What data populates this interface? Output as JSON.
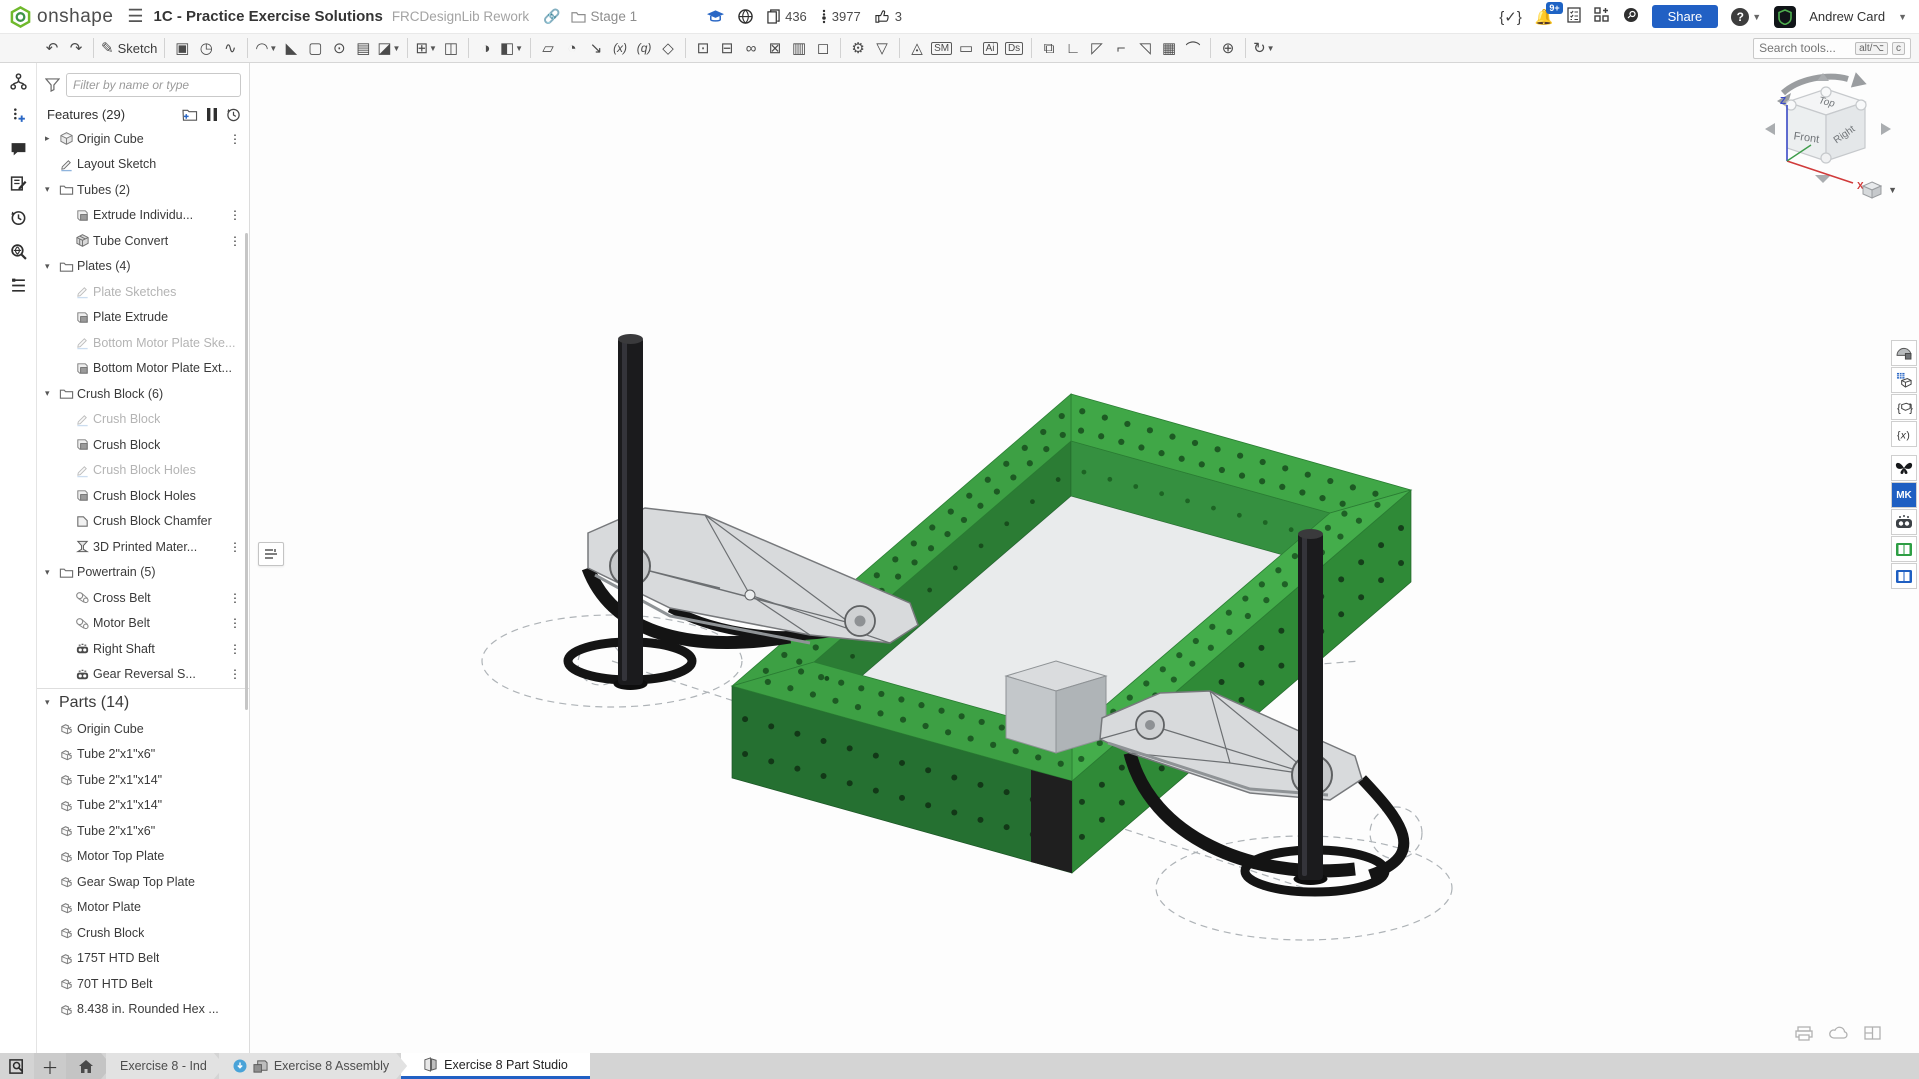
{
  "app": {
    "brand": "onshape",
    "title": "1C - Practice Exercise Solutions",
    "subtitle": "FRCDesignLib Rework",
    "workspace": "Stage 1",
    "stats": {
      "copies": "436",
      "views": "3977",
      "likes": "3"
    },
    "notification_badge": "9+",
    "share_label": "Share",
    "user_name": "Andrew Card",
    "accent_color": "#2160c4",
    "logo_green": "#6fb92c"
  },
  "left_rail": {
    "icons": [
      "versions",
      "follow",
      "comments",
      "release-notes",
      "history",
      "search",
      "feature-list"
    ]
  },
  "toolbar": {
    "sketch_label": "Sketch",
    "search_placeholder": "Search tools...",
    "shortcut_keys": [
      "alt/⌥",
      "c"
    ],
    "icons": [
      {
        "name": "undo-icon",
        "glyph": "↶"
      },
      {
        "name": "redo-icon",
        "glyph": "↷"
      },
      {
        "sep": true
      },
      {
        "name": "sketch-icon",
        "glyph": "✎",
        "label": "Sketch"
      },
      {
        "sep": true
      },
      {
        "name": "extrude-icon",
        "glyph": "▣"
      },
      {
        "name": "revolve-icon",
        "glyph": "◷"
      },
      {
        "name": "sweep-icon",
        "glyph": "∿"
      },
      {
        "sep": true
      },
      {
        "name": "fillet-icon",
        "glyph": "◠",
        "caret": true
      },
      {
        "name": "chamfer-icon",
        "glyph": "◣"
      },
      {
        "name": "shell-icon",
        "glyph": "▢"
      },
      {
        "name": "hole-icon",
        "glyph": "⊙"
      },
      {
        "name": "thread-icon",
        "glyph": "▤"
      },
      {
        "name": "draft-icon",
        "glyph": "◪",
        "caret": true
      },
      {
        "sep": true
      },
      {
        "name": "pattern-icon",
        "glyph": "⊞",
        "caret": true
      },
      {
        "name": "mirror-icon",
        "glyph": "◫"
      },
      {
        "sep": true
      },
      {
        "name": "boolean-icon",
        "glyph": "◑"
      },
      {
        "name": "split-icon",
        "glyph": "◧",
        "caret": true
      },
      {
        "sep": true
      },
      {
        "name": "plane-icon",
        "glyph": "▱"
      },
      {
        "name": "helix-icon",
        "glyph": "◔"
      },
      {
        "name": "import-icon",
        "glyph": "↘"
      },
      {
        "name": "variable-icon",
        "glyph": "(x)",
        "text": true
      },
      {
        "name": "variable-studio-icon",
        "glyph": "(q)",
        "text": true
      },
      {
        "name": "custom-feature-icon",
        "glyph": "◇"
      },
      {
        "sep": true
      },
      {
        "name": "part-insert-icon",
        "glyph": "⊡"
      },
      {
        "name": "robot-feature-icon",
        "glyph": "⊟"
      },
      {
        "name": "belt-feature-icon",
        "glyph": "∞"
      },
      {
        "name": "robot-feature2-icon",
        "glyph": "⊠"
      },
      {
        "name": "sheet-icon",
        "glyph": "▥"
      },
      {
        "name": "weldment-icon",
        "glyph": "◻"
      },
      {
        "sep": true
      },
      {
        "name": "gear-feature-icon",
        "glyph": "⚙"
      },
      {
        "name": "filter-feature-icon",
        "glyph": "▽"
      },
      {
        "sep": true
      },
      {
        "name": "lamp-icon",
        "glyph": "◬"
      },
      {
        "name": "sheet-metal-icon",
        "glyph": "SM",
        "boxed": true
      },
      {
        "name": "battery-icon",
        "glyph": "▭"
      },
      {
        "name": "ai-icon",
        "glyph": "Ai",
        "boxed": true
      },
      {
        "name": "ds-icon",
        "glyph": "Ds",
        "boxed": true
      },
      {
        "sep": true
      },
      {
        "name": "fold-icon",
        "glyph": "⧉"
      },
      {
        "name": "bend-icon",
        "glyph": "∟"
      },
      {
        "name": "flatten-icon",
        "glyph": "◸"
      },
      {
        "name": "flange-icon",
        "glyph": "⌐"
      },
      {
        "name": "corner-icon",
        "glyph": "◹"
      },
      {
        "name": "drawing-icon",
        "glyph": "▦"
      },
      {
        "name": "tube-icon",
        "glyph": "⌒"
      },
      {
        "sep": true
      },
      {
        "name": "origin-target-icon",
        "glyph": "⊕"
      },
      {
        "sep": true
      },
      {
        "name": "automate-icon",
        "glyph": "↻",
        "caret": true
      }
    ]
  },
  "features": {
    "filter_placeholder": "Filter by name or type",
    "header": "Features (29)",
    "header_icons": [
      "new-folder-icon",
      "suppress-icon",
      "rollback-icon"
    ],
    "items": [
      {
        "label": "Origin Cube",
        "icon": "cube",
        "expander": "right",
        "dots": true
      },
      {
        "label": "Layout Sketch",
        "icon": "sketch"
      },
      {
        "label": "Tubes (2)",
        "icon": "folder",
        "expander": "down"
      },
      {
        "label": "Extrude Individu...",
        "icon": "extrude",
        "indent": 1,
        "dots": true
      },
      {
        "label": "Tube Convert",
        "icon": "convert",
        "indent": 1,
        "dots": true
      },
      {
        "label": "Plates (4)",
        "icon": "folder",
        "expander": "down"
      },
      {
        "label": "Plate Sketches",
        "icon": "sketch",
        "indent": 1,
        "disabled": true
      },
      {
        "label": "Plate Extrude",
        "icon": "extrude",
        "indent": 1
      },
      {
        "label": "Bottom Motor Plate Ske...",
        "icon": "sketch",
        "indent": 1,
        "disabled": true
      },
      {
        "label": "Bottom Motor Plate Ext...",
        "icon": "extrude",
        "indent": 1
      },
      {
        "label": "Crush Block (6)",
        "icon": "folder",
        "expander": "down"
      },
      {
        "label": "Crush Block",
        "icon": "sketch",
        "indent": 1,
        "disabled": true
      },
      {
        "label": "Crush Block",
        "icon": "extrude",
        "indent": 1
      },
      {
        "label": "Crush Block Holes",
        "icon": "sketch",
        "indent": 1,
        "disabled": true
      },
      {
        "label": "Crush Block Holes",
        "icon": "extrude",
        "indent": 1
      },
      {
        "label": "Crush Block Chamfer",
        "icon": "chamfer",
        "indent": 1
      },
      {
        "label": "3D Printed Mater...",
        "icon": "material",
        "indent": 1,
        "dots": true
      },
      {
        "label": "Powertrain (5)",
        "icon": "folder",
        "expander": "down"
      },
      {
        "label": "Cross Belt",
        "icon": "belt",
        "indent": 1,
        "dots": true
      },
      {
        "label": "Motor Belt",
        "icon": "belt",
        "indent": 1,
        "dots": true
      },
      {
        "label": "Right Shaft",
        "icon": "shaft",
        "indent": 1,
        "dots": true
      },
      {
        "label": "Gear Reversal S...",
        "icon": "shaft",
        "indent": 1,
        "dots": true
      }
    ]
  },
  "parts": {
    "header": "Parts (14)",
    "items": [
      {
        "label": "Origin Cube",
        "icon": "part"
      },
      {
        "label": "Tube 2\"x1\"x6\"",
        "icon": "part"
      },
      {
        "label": "Tube 2\"x1\"x14\"",
        "icon": "part"
      },
      {
        "label": "Tube 2\"x1\"x14\"",
        "icon": "part"
      },
      {
        "label": "Tube 2\"x1\"x6\"",
        "icon": "part"
      },
      {
        "label": "Motor Top Plate",
        "icon": "part"
      },
      {
        "label": "Gear Swap Top Plate",
        "icon": "part"
      },
      {
        "label": "Motor Plate",
        "icon": "part"
      },
      {
        "label": "Crush Block",
        "icon": "part"
      },
      {
        "label": "175T HTD Belt",
        "icon": "part"
      },
      {
        "label": "70T HTD Belt",
        "icon": "part"
      },
      {
        "label": "8.438 in. Rounded Hex ...",
        "icon": "part"
      }
    ]
  },
  "viewcube": {
    "top": "Top",
    "front": "Front",
    "right": "Right",
    "axis_z": "Z",
    "axis_x": "X"
  },
  "right_stacks": {
    "group_a": [
      "appearance-panel",
      "bom-panel",
      "custom-panel",
      "configuration-panel"
    ],
    "group_b": [
      "butterfly-app",
      "mkcad-app",
      "robot-app",
      "green-library-app",
      "blue-library-app"
    ],
    "mk_label": "MK"
  },
  "tabs": [
    {
      "label": "Exercise 8 - Ind",
      "type": "partstudio"
    },
    {
      "label": "Exercise 8 Assembly",
      "type": "assembly"
    },
    {
      "label": "Exercise 8 Part Studio",
      "type": "partstudio",
      "active": true
    }
  ]
}
